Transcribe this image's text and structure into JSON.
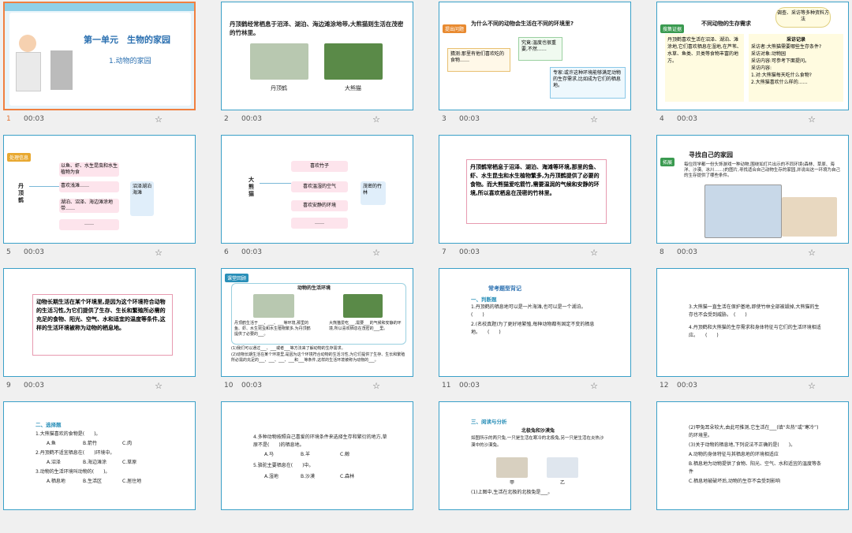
{
  "slides": [
    {
      "num": "1",
      "time": "00:03",
      "title": "第一单元　生物的家园",
      "subtitle": "1.动物的家园"
    },
    {
      "num": "2",
      "time": "00:03",
      "text": "丹顶鹤经常栖息于沼泽、湖泊、海边滩涂地带,大熊猫则生活在茂密的竹林里。",
      "label1": "丹顶鹤",
      "label2": "大熊猫"
    },
    {
      "num": "3",
      "time": "00:03",
      "question": "为什么不同的动物会生活在不同的环境里?",
      "bubble1": "猜测:那里有他们喜欢吃的食物……",
      "bubble2": "究竟:温度也很重要,不然……",
      "bubble3": "专家:或许这种环境能够满足动物的生存需求,比如成为它们的栖息地。",
      "tag": "提出问题"
    },
    {
      "num": "4",
      "time": "00:03",
      "title": "不同动物的生存需求",
      "cloud": "调查、采访等多种资料方法",
      "left": "丹顶鹤喜欢生活在沼泽、湖泊、滩涂地,它们喜欢栖息在湿地,在芦苇、水草、鱼类、贝类等食物丰富的地方。",
      "right_title": "采访记录",
      "right_lines": [
        "采访者:大熊猫需要哪些生存条件?",
        "采访对象:动物园",
        "采访内容:可参考下面提问。",
        "采访内容:",
        "1.对:大熊猫每天吃什么食物?",
        "2.大熊猫喜欢什么样的……"
      ],
      "tag": "搜集证据"
    },
    {
      "num": "5",
      "time": "00:03",
      "animal": "丹顶鹤",
      "items": [
        "以鱼、虾、水生昆虫和水生植物为食",
        "喜欢浅滩……",
        "湖泊、沼泽、海边滩涂地带……",
        "……"
      ],
      "result": "沼泽湖泊海滩",
      "tag": "处理信息"
    },
    {
      "num": "6",
      "time": "00:03",
      "animal": "大熊猫",
      "items": [
        "喜欢竹子",
        "喜欢温湿的空气",
        "喜欢安静的环境",
        "……"
      ],
      "result": "茂密的竹林"
    },
    {
      "num": "7",
      "time": "00:03",
      "text": "丹顶鹤常栖息于沼泽、湖泊、海滩等环境,那里的鱼、虾、水生昆虫和水生植物繁多,为丹顶鹤提供了必要的食物。而大熊猫爱吃箭竹,需要温润的气候和安静的环境,所以喜欢栖息在茂密的竹林里。"
    },
    {
      "num": "8",
      "time": "00:03",
      "title": "寻找自己的家园",
      "text": "每位同学都一份头饰游戏一种动物,围绕如灯片出示的不同环境(森林、草原、海洋、沙漠、冰川……)的图片,寻找适合自己动物生存的家园,并说出这一环境为自己的生存提供了哪些条件。",
      "tag": "拓展"
    },
    {
      "num": "9",
      "time": "00:03",
      "text": "动物长期生活在某个环境里,是因为这个环境符合动物的生活习性,为它们提供了生存、生长和繁殖所必需的充足的食物、阳光、空气、水和适宜的温度等条件,这样的生活环境被称为动物的栖息地。"
    },
    {
      "num": "10",
      "time": "00:03",
      "header": "动物的生活环境",
      "left": "丹顶鹤生活于___、___、___等环境,那里的鱼、虾、水生昆虫和水生植物繁多,为丹顶鹤提供了必要的___。",
      "right": "大熊猫爱吃___,需要___的气候和安静的环境,所以喜欢栖息在茂密的___里。",
      "q1": "(1)我们可以通过___、___或者___等方法来了解动物的生存需求。",
      "q2": "(2)动物长期生活在某个环境里,是因为这个环境符合动物的生活习性,为它们提供了生存、生长和繁殖所必需的充足的___、___、___、___和___等条件,这样的生活环境被称为动物的___。",
      "tag": "课堂回顾"
    },
    {
      "num": "11",
      "time": "00:03",
      "title": "常考题型背记",
      "section": "一、判断题",
      "q1": "1.丹顶鹤的栖息地可以是一片海滩,也可以是一个湖泊。　　　　　(　　)",
      "q2": "2.(名校真题)为了更好地繁殖,每种动物都有固定不变的栖息地。　　(　　)"
    },
    {
      "num": "12",
      "time": "00:03",
      "q3": "3.大熊猫一直生活在保护基地,即使竹林全部被毁掉,大熊猫的生存也不会受到威胁。　(　　)",
      "q4": "4.丹顶鹤和大熊猫的生存需求和身体特征与它们的生活环境相适应。　　(　　)"
    },
    {
      "num": "13",
      "time": "",
      "section": "二、选择题",
      "q1": "1.大熊猫喜欢的食物是(　　)。",
      "q1o": [
        "A.鱼",
        "B.箭竹",
        "C.肉"
      ],
      "q2": "2.丹顶鹤不适宜栖息在(　　)环境中。",
      "q2o": [
        "A.沼泽",
        "B.海边滩涂",
        "C.草原"
      ],
      "q3": "3.动物的生活环境叫动物的(　　)。",
      "q3o": [
        "A.栖息地",
        "B.生活区",
        "C.居住地"
      ]
    },
    {
      "num": "14",
      "time": "",
      "q4": "4.多种动物按照自己喜爱的环境条件来选择生存和繁衍的地方,草原不是(　　)的栖息地。",
      "q4o": [
        "A.马",
        "B.羊",
        "C.鲸"
      ],
      "q5": "5.骆驼主要栖息在(　　)中。",
      "q5o": [
        "A.湿地",
        "B.沙漠",
        "C.森林"
      ]
    },
    {
      "num": "15",
      "time": "",
      "section": "三、阅读与分析",
      "subtitle": "北极兔和沙漠兔",
      "text": "如图所示的两只兔,一只是生活在寒冷的北极兔,另一只是生活在炎热沙漠中的沙漠兔。",
      "label1": "甲",
      "label2": "乙",
      "q": "(1)上图中,生活在北极的北极兔是___。"
    },
    {
      "num": "16",
      "time": "",
      "q2": "(2)甲兔耳朵较大,由此可推测,它生活在___(填“炎热”或“寒冷”)的环境里。",
      "q3": "(3)关于动物的栖息地,下列说法不正确的是(　　)。",
      "o": [
        "A.动物的身体特征与其栖息地的环境相适应",
        "B.栖息地为动物提供了食物、阳光、空气、水和适宜的温度等条件",
        "C.栖息地被破坏后,动物的生存不会受到影响"
      ]
    }
  ]
}
